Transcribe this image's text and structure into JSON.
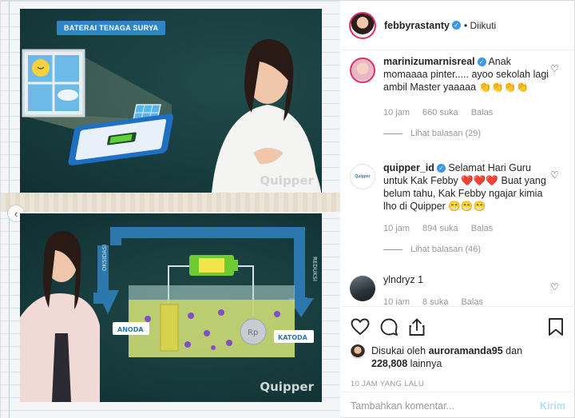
{
  "post": {
    "top_label": "BATERAI TENAGA SURYA",
    "watermark": "Quipper",
    "bottom_labels": {
      "left_vertical": "OKSIDASI",
      "right_vertical": "REDUKSI",
      "anode": "ANODA",
      "cathode": "KATODA",
      "coin": "Rp"
    }
  },
  "header": {
    "username": "febbyrastanty",
    "follow_text": "• Diikuti"
  },
  "comments": [
    {
      "username": "marinizumarnisreal",
      "text": "Anak momaaaa pinter..... ayoo sekolah lagi ambil Master yaaaaa",
      "emoji": "👏👏👏👏",
      "time": "10 jam",
      "likes": "660 suka",
      "reply": "Balas",
      "view_replies": "Lihat balasan (29)"
    },
    {
      "username": "quipper_id",
      "text": "Selamat Hari Guru untuk Kak Febby",
      "hearts": "❤️❤️❤️",
      "text2": "Buat yang belum tahu, Kak Febby ngajar kimia lho di Quipper",
      "emoji": "😁😁😁",
      "time": "10 jam",
      "likes": "894 suka",
      "reply": "Balas",
      "view_replies": "Lihat balasan (46)"
    },
    {
      "username": "ylndryz",
      "text": "1",
      "time": "10 jam",
      "likes": "8 suka",
      "reply": "Balas"
    }
  ],
  "likes": {
    "prefix": "Disukai oleh",
    "user": "auroramanda95",
    "and": "dan",
    "count": "228,808",
    "suffix": "lainnya"
  },
  "timestamp": "10 JAM YANG LALU",
  "composer": {
    "placeholder": "Tambahkan komentar...",
    "post_label": "Kirim"
  },
  "colors": {
    "accent": "#3897f0",
    "post_disabled": "#b2dffc",
    "board": "#163a3b"
  }
}
